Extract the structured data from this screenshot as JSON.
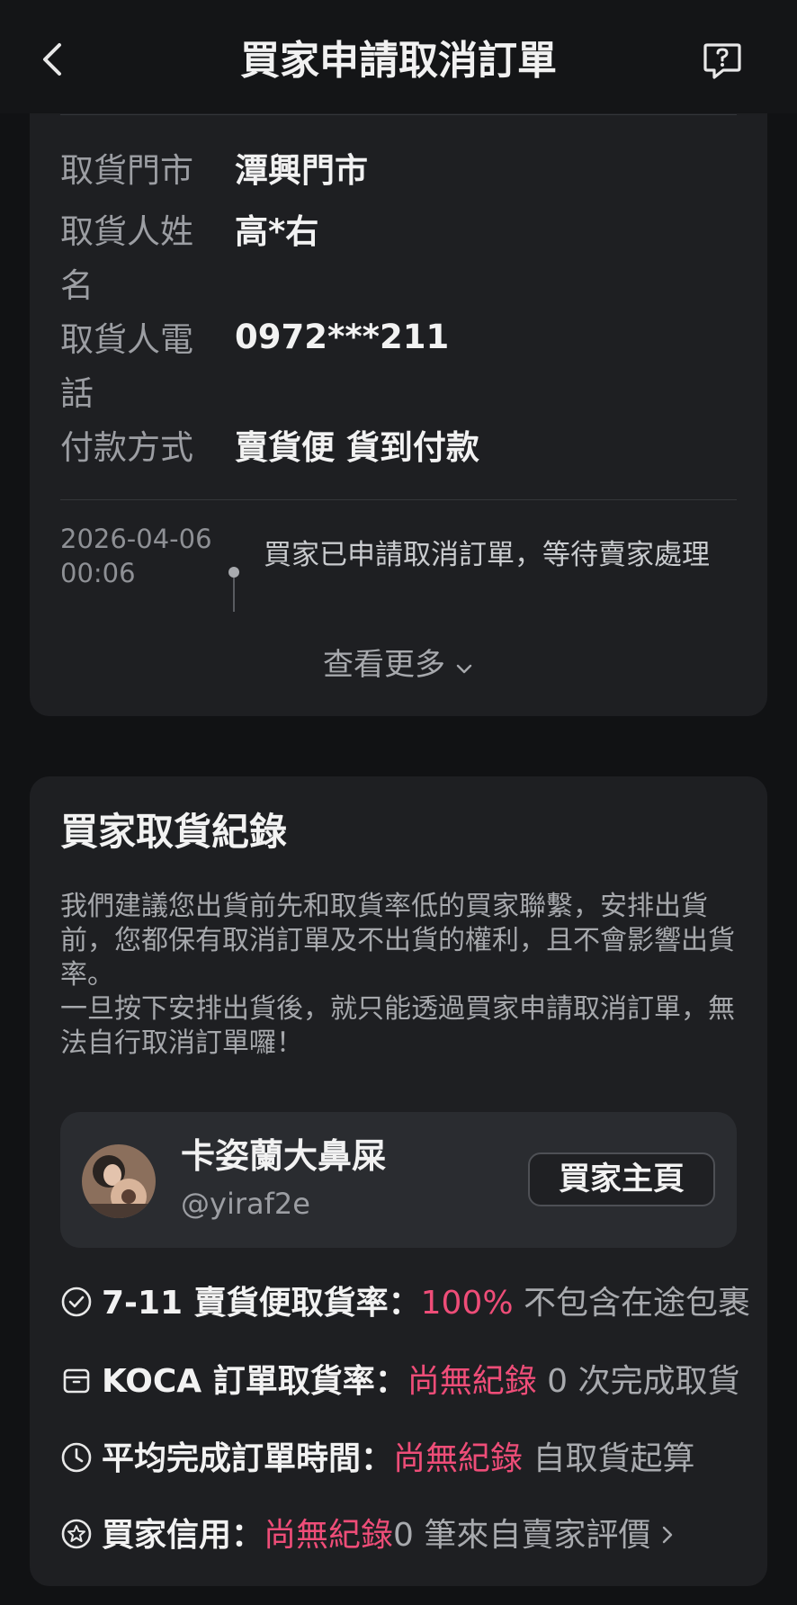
{
  "header": {
    "title": "買家申請取消訂單"
  },
  "order": {
    "fields": [
      {
        "label": "取貨門市",
        "value": "潭興門市"
      },
      {
        "label": "取貨人姓名",
        "value": "高*右"
      },
      {
        "label": "取貨人電話",
        "value": "0972***211"
      },
      {
        "label": "付款方式",
        "value": "賣貨便 貨到付款"
      }
    ],
    "timeline": {
      "timestamp": "2026-04-06 00:06",
      "event": "買家已申請取消訂單，等待賣家處理"
    },
    "more_label": "查看更多"
  },
  "pickup_record": {
    "title": "買家取貨紀錄",
    "notice_1": "我們建議您出貨前先和取貨率低的買家聯繫，安排出貨前，您都保有取消訂單及不出貨的權利，且不會影響出貨率。",
    "notice_2": "一旦按下安排出貨後，就只能透過買家申請取消訂單，無法自行取消訂單囉！",
    "buyer": {
      "name": "卡姿蘭大鼻屎",
      "handle": "@yiraf2e",
      "home_button": "買家主頁"
    },
    "stats": [
      {
        "icon": "check-circle-icon",
        "label": "7-11 賣貨便取貨率：",
        "value": "100%",
        "note": "不包含在途包裹"
      },
      {
        "icon": "package-icon",
        "label": "KOCA 訂單取貨率：",
        "value": "尚無紀錄",
        "note": "0 次完成取貨"
      },
      {
        "icon": "clock-icon",
        "label": "平均完成訂單時間：",
        "value": "尚無紀錄",
        "note": "自取貨起算"
      },
      {
        "icon": "star-badge-icon",
        "label": "買家信用：",
        "value": "尚無紀錄",
        "note": "0 筆來自賣家評價"
      }
    ]
  },
  "colors": {
    "background": "#111214",
    "card": "#1e1f22",
    "highlight": "#ee4d78"
  }
}
